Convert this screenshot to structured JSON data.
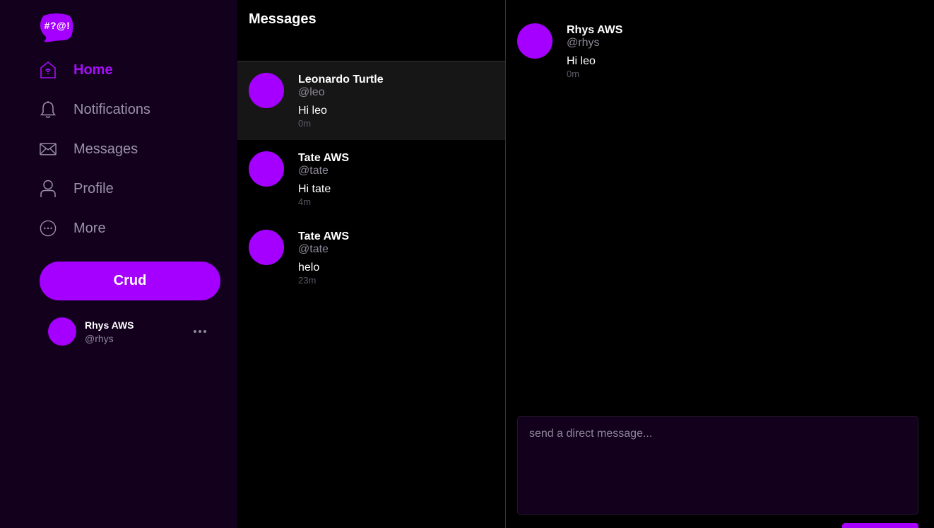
{
  "sidebar": {
    "logo_text": "#?@!",
    "nav": [
      {
        "label": "Home",
        "icon": "home-icon",
        "active": true
      },
      {
        "label": "Notifications",
        "icon": "bell-icon",
        "active": false
      },
      {
        "label": "Messages",
        "icon": "envelope-icon",
        "active": false
      },
      {
        "label": "Profile",
        "icon": "user-icon",
        "active": false
      },
      {
        "label": "More",
        "icon": "more-circle-icon",
        "active": false
      }
    ],
    "crud_label": "Crud",
    "current_user": {
      "name": "Rhys AWS",
      "handle": "@rhys"
    }
  },
  "messages": {
    "title": "Messages",
    "conversations": [
      {
        "name": "Leonardo Turtle",
        "handle": "@leo",
        "text": "Hi leo",
        "time": "0m",
        "selected": true
      },
      {
        "name": "Tate AWS",
        "handle": "@tate",
        "text": "Hi tate",
        "time": "4m",
        "selected": false
      },
      {
        "name": "Tate AWS",
        "handle": "@tate",
        "text": "helo",
        "time": "23m",
        "selected": false
      }
    ]
  },
  "conversation": {
    "messages": [
      {
        "name": "Rhys AWS",
        "handle": "@rhys",
        "text": "Hi leo",
        "time": "0m"
      }
    ],
    "input_placeholder": "send a direct message..."
  },
  "colors": {
    "accent": "#a500ff",
    "sidebar_bg": "#12001d",
    "selected_row_bg": "#161616",
    "muted_text": "#8d8797"
  }
}
